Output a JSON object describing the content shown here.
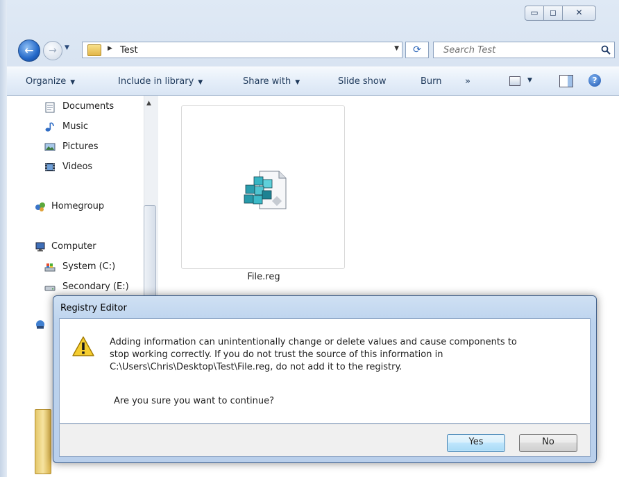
{
  "window": {
    "caption": {
      "minimize": "▭",
      "maximize": "◻",
      "close": "✕"
    }
  },
  "address_bar": {
    "path": "Test",
    "search_placeholder": "Search Test"
  },
  "toolbar": {
    "organize": "Organize",
    "include_in_library": "Include in library",
    "share_with": "Share with",
    "slide_show": "Slide show",
    "burn": "Burn",
    "more": "»"
  },
  "nav_pane": {
    "items": [
      {
        "label": "Documents",
        "icon": "documents-icon"
      },
      {
        "label": "Music",
        "icon": "music-icon"
      },
      {
        "label": "Pictures",
        "icon": "pictures-icon"
      },
      {
        "label": "Videos",
        "icon": "videos-icon"
      },
      {
        "label": "Homegroup",
        "icon": "homegroup-icon"
      },
      {
        "label": "Computer",
        "icon": "computer-icon"
      },
      {
        "label": "System (C:)",
        "icon": "drive-c-icon"
      },
      {
        "label": "Secondary (E:)",
        "icon": "drive-e-icon"
      }
    ]
  },
  "content": {
    "file_name": "File.reg",
    "file_icon": "registry-file-icon"
  },
  "dialog": {
    "title": "Registry Editor",
    "message_line1": "Adding information can unintentionally change or delete values and cause components to",
    "message_line2": "stop working correctly. If you do not trust the source of this information in",
    "message_line3": "C:\\Users\\Chris\\Desktop\\Test\\File.reg, do not add it to the registry.",
    "question": "Are you sure you want to continue?",
    "yes_label": "Yes",
    "no_label": "No"
  },
  "colors": {
    "toolbar_text": "#1e395b",
    "dialog_frame": "#b9cfeb",
    "default_button_border": "#3c7fb1"
  }
}
